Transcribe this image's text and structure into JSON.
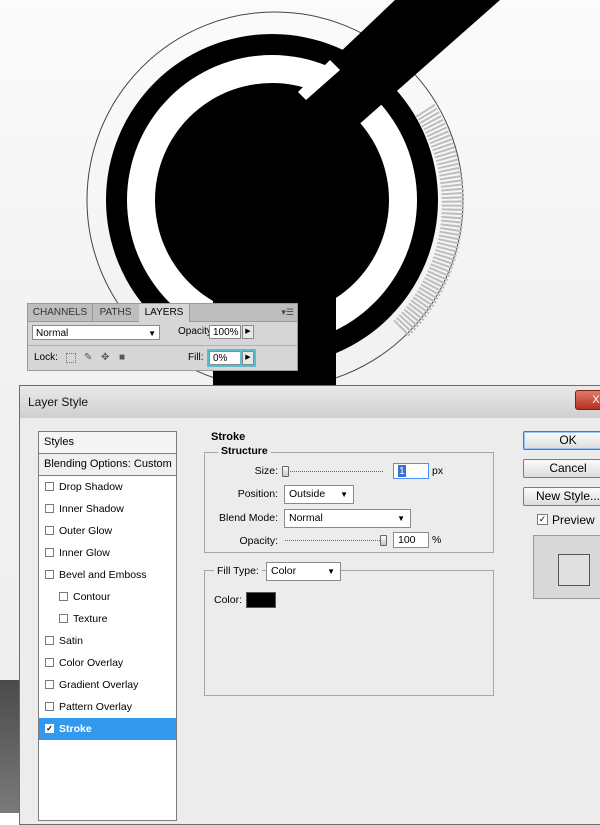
{
  "layers_panel": {
    "tabs": [
      {
        "label": "CHANNELS"
      },
      {
        "label": "PATHS"
      },
      {
        "label": "LAYERS"
      }
    ],
    "blend_mode": "Normal",
    "opacity_label": "Opacity:",
    "opacity_value": "100%",
    "lock_label": "Lock:",
    "fill_label": "Fill:",
    "fill_value": "0%"
  },
  "dialog": {
    "title": "Layer Style",
    "close_label": "X",
    "styles_list": {
      "header": "Styles",
      "blending": "Blending Options: Custom",
      "items": [
        {
          "label": "Drop Shadow",
          "checked": false
        },
        {
          "label": "Inner Shadow",
          "checked": false
        },
        {
          "label": "Outer Glow",
          "checked": false
        },
        {
          "label": "Inner Glow",
          "checked": false
        },
        {
          "label": "Bevel and Emboss",
          "checked": false
        },
        {
          "label": "Contour",
          "checked": false
        },
        {
          "label": "Texture",
          "checked": false
        },
        {
          "label": "Satin",
          "checked": false
        },
        {
          "label": "Color Overlay",
          "checked": false
        },
        {
          "label": "Gradient Overlay",
          "checked": false
        },
        {
          "label": "Pattern Overlay",
          "checked": false
        },
        {
          "label": "Stroke",
          "checked": true
        }
      ],
      "check_glyph": "✓"
    },
    "stroke": {
      "section_title": "Stroke",
      "structure_title": "Structure",
      "size_label": "Size:",
      "size_value": "1",
      "size_unit": "px",
      "position_label": "Position:",
      "position_value": "Outside",
      "blend_label": "Blend Mode:",
      "blend_value": "Normal",
      "opacity_label": "Opacity:",
      "opacity_value": "100",
      "opacity_unit": "%",
      "fill_type_label": "Fill Type:",
      "fill_type_value": "Color",
      "color_label": "Color:",
      "color_hex": "#000000"
    },
    "buttons": {
      "ok": "OK",
      "cancel": "Cancel",
      "new_style": "New Style...",
      "preview_label": "Preview",
      "preview_checked": true
    }
  },
  "colors": {
    "selection_blue": "#3399ee",
    "fill_focus": "#55c0d0",
    "close_red": "#b4311f"
  }
}
